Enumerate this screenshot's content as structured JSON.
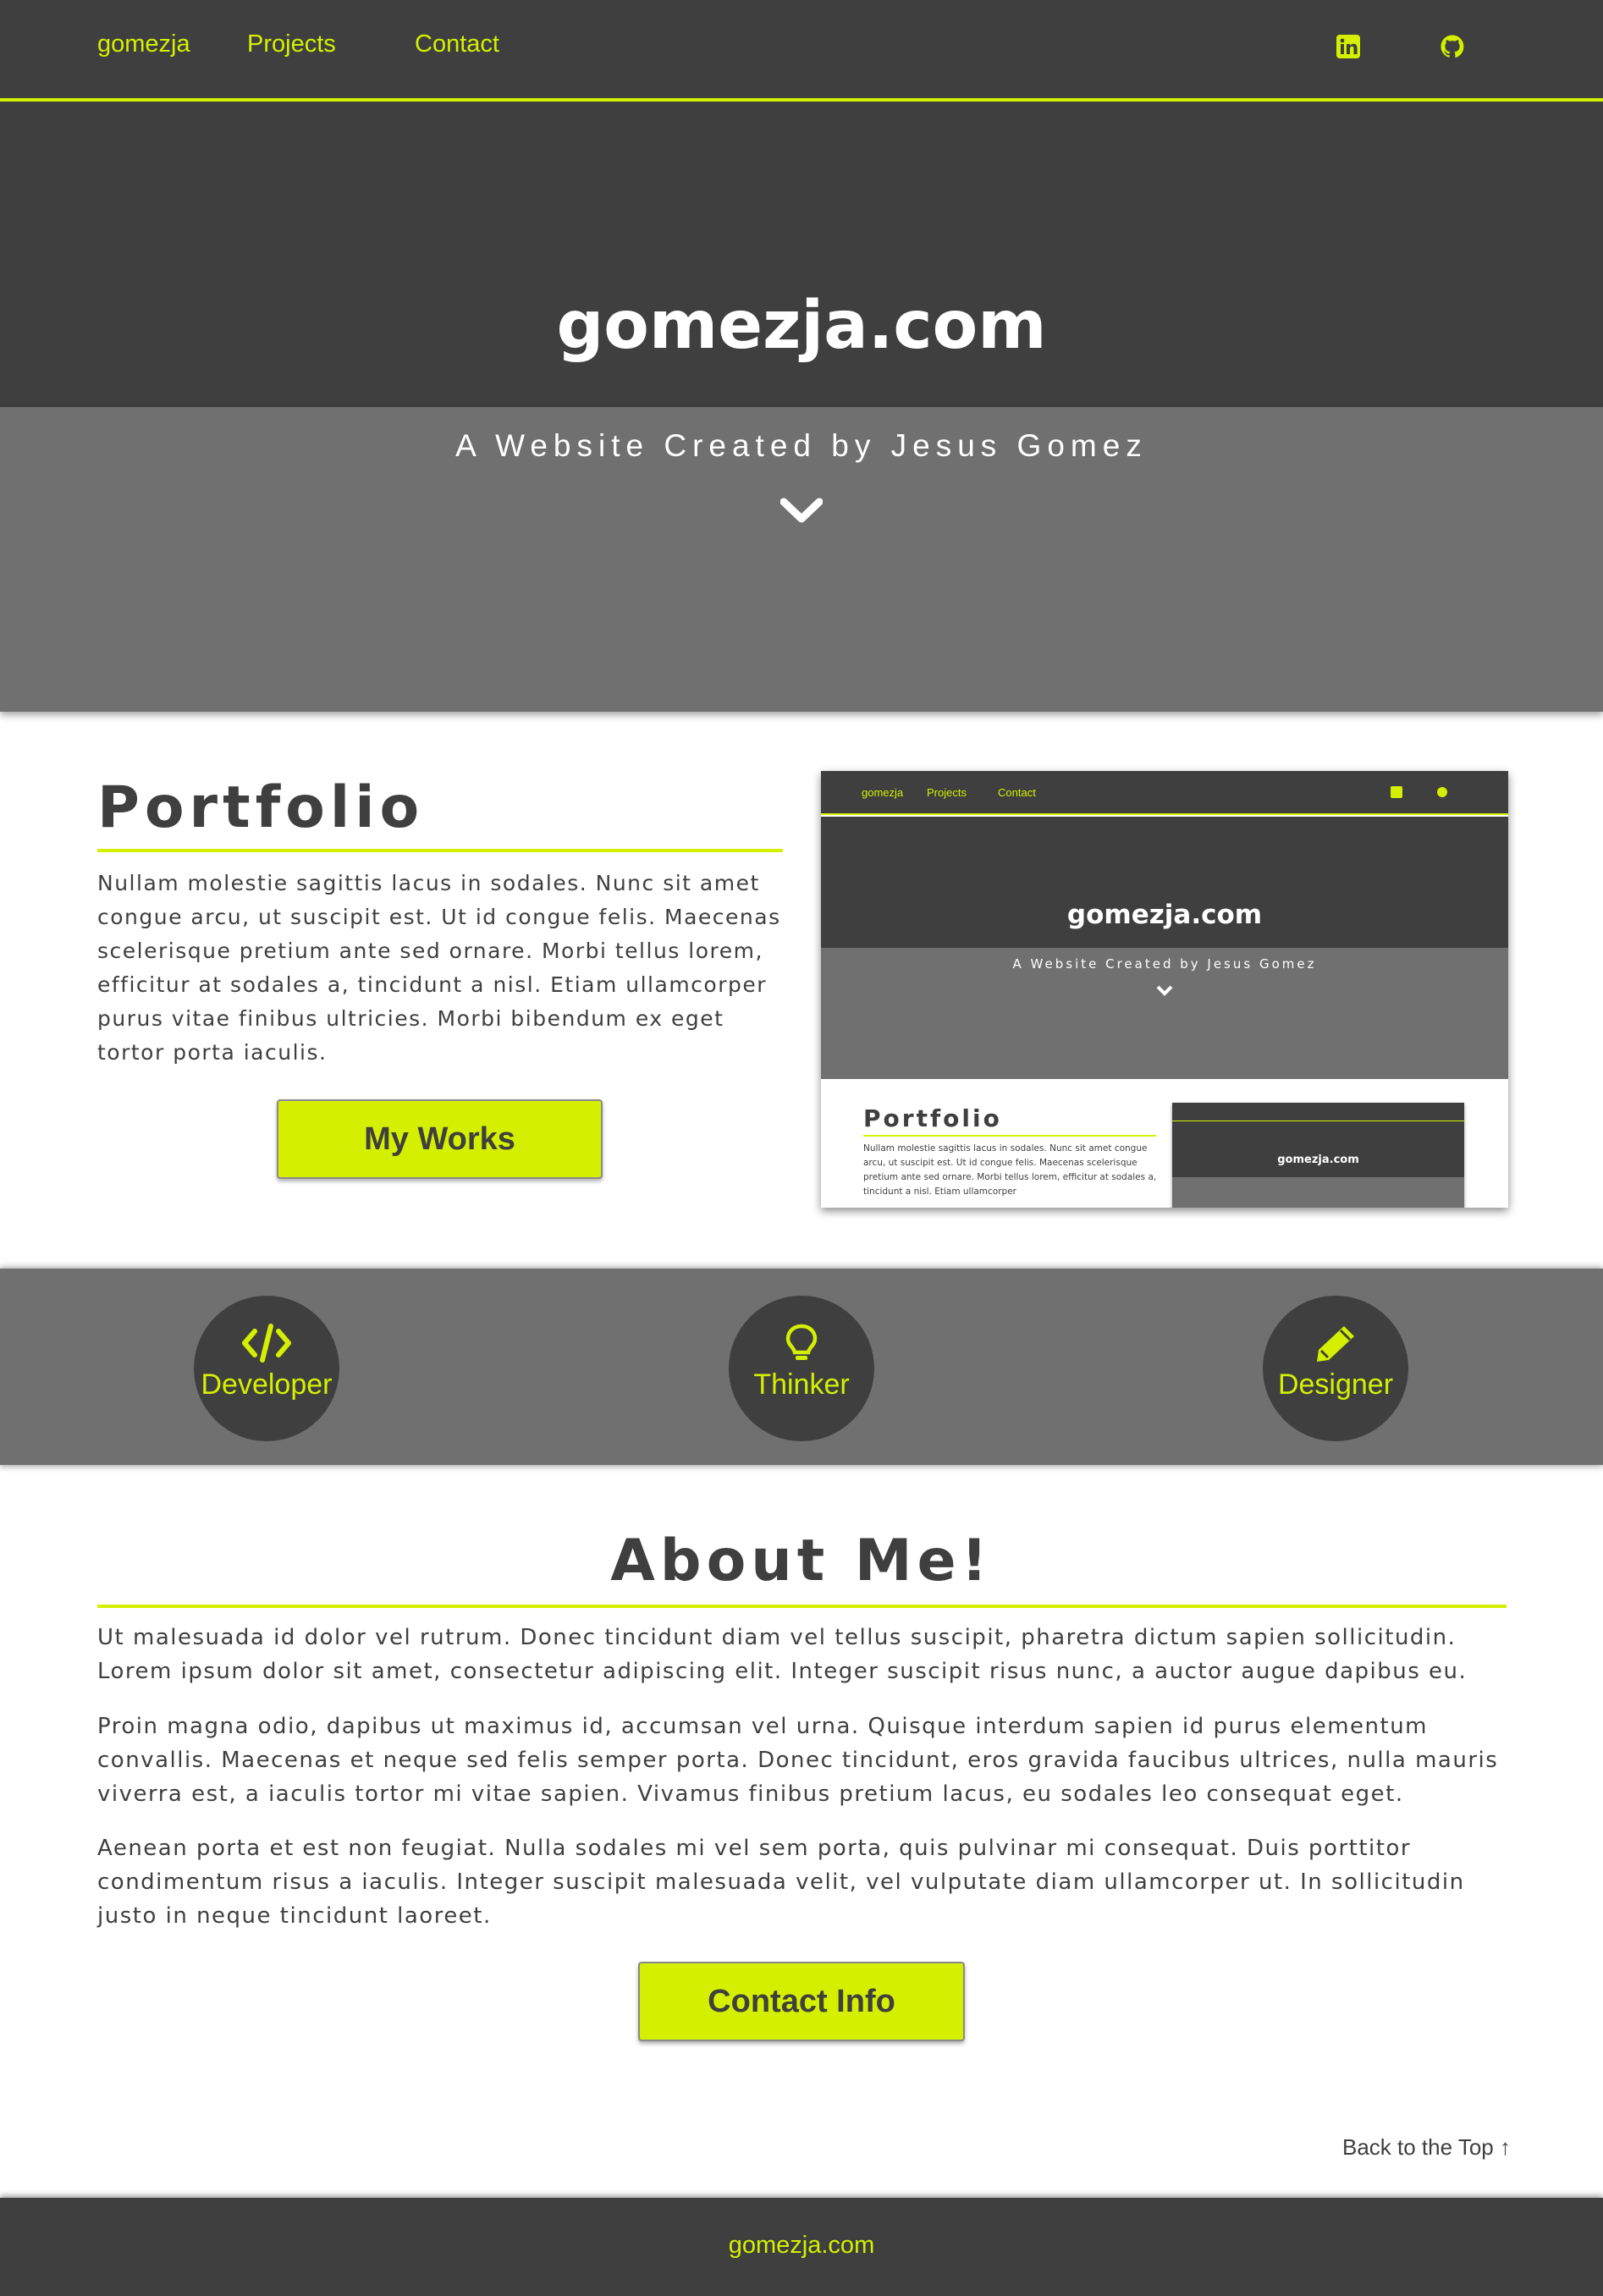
{
  "nav": {
    "brand": "gomezja",
    "projects": "Projects",
    "contact": "Contact",
    "icons": [
      "linkedin-icon",
      "github-icon"
    ]
  },
  "hero": {
    "title": "gomezja.com",
    "subtitle": "A Website Created by Jesus Gomez",
    "scroll_icon": "chevron-down-icon"
  },
  "portfolio": {
    "title": "Portfolio",
    "text": "Nullam molestie sagittis lacus in sodales. Nunc sit amet congue arcu, ut suscipit est. Ut id congue felis. Maecenas scelerisque pretium ante sed ornare. Morbi tellus lorem, efficitur at sodales a, tincidunt a nisl. Etiam ullamcorper purus vitae finibus ultricies. Morbi bibendum ex eget tortor porta iaculis.",
    "button": "My Works",
    "preview": {
      "nav_brand": "gomezja",
      "nav_projects": "Projects",
      "nav_contact": "Contact",
      "title": "gomezja.com",
      "subtitle": "A Website Created by Jesus Gomez",
      "portfolio_title": "Portfolio",
      "portfolio_text": "Nullam molestie sagittis lacus in sodales. Nunc sit amet congue arcu, ut suscipit est. Ut id congue felis. Maecenas scelerisque pretium ante sed ornare. Morbi tellus lorem, efficitur at sodales a, tincidunt a nisl. Etiam ullamcorper"
    }
  },
  "skills": [
    {
      "label": "Developer",
      "icon": "code-icon"
    },
    {
      "label": "Thinker",
      "icon": "lightbulb-icon"
    },
    {
      "label": "Designer",
      "icon": "pencil-icon"
    }
  ],
  "about": {
    "title": "About Me!",
    "paragraphs": [
      "Ut malesuada id dolor vel rutrum. Donec tincidunt diam vel tellus suscipit, pharetra dictum sapien sollicitudin. Lorem ipsum dolor sit amet, consectetur adipiscing elit. Integer suscipit risus nunc, a auctor augue dapibus eu.",
      "Proin magna odio, dapibus ut maximus id, accumsan vel urna. Quisque interdum sapien id purus elementum convallis. Maecenas et neque sed felis semper porta. Donec tincidunt, eros gravida faucibus ultrices, nulla mauris viverra est, a iaculis tortor mi vitae sapien. Vivamus finibus pretium lacus, eu sodales leo consequat eget.",
      "Aenean porta et est non feugiat. Nulla sodales mi vel sem porta, quis pulvinar mi consequat. Duis porttitor condimentum risus a iaculis. Integer suscipit malesuada velit, vel vulputate diam ullamcorper ut. In sollicitudin justo in neque tincidunt laoreet."
    ],
    "button": "Contact Info"
  },
  "back_to_top": "Back to the Top",
  "footer": {
    "text": "gomezja.com"
  },
  "colors": {
    "accent": "#d4f000",
    "dark": "#3f3f3f",
    "mid": "#707070"
  }
}
